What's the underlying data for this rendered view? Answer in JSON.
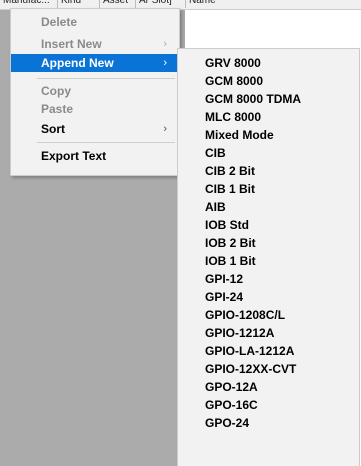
{
  "grid": {
    "columns": [
      "Manufac...",
      "Kind",
      "Asset",
      "Ar Slot]",
      "Name",
      ""
    ]
  },
  "context_menu": {
    "items": [
      {
        "label": "Delete",
        "enabled": false,
        "submenu": false
      },
      {
        "label": "Insert New",
        "enabled": false,
        "submenu": true
      },
      {
        "label": "Append New",
        "enabled": true,
        "submenu": true,
        "highlighted": true
      },
      {
        "label": "Copy",
        "enabled": false,
        "submenu": false
      },
      {
        "label": "Paste",
        "enabled": false,
        "submenu": false
      },
      {
        "label": "Sort",
        "enabled": true,
        "submenu": true
      },
      {
        "label": "Export Text",
        "enabled": true,
        "submenu": false
      }
    ],
    "submenu_arrow": "›"
  },
  "append_new_submenu": {
    "items": [
      "GRV 8000",
      "GCM 8000",
      "GCM 8000 TDMA",
      "MLC 8000",
      "Mixed Mode",
      "CIB",
      "CIB 2 Bit",
      "CIB 1 Bit",
      "AIB",
      "IOB Std",
      "IOB 2 Bit",
      "IOB 1 Bit",
      "GPI-12",
      "GPI-24",
      "GPIO-1208C/L",
      "GPIO-1212A",
      "GPIO-LA-1212A",
      "GPIO-12XX-CVT",
      "GPO-12A",
      "GPO-16C",
      "GPO-24"
    ]
  },
  "colors": {
    "highlight": "#0a74d6",
    "menu_background": "#f2f2f2",
    "disabled_text": "#8a8a8a",
    "app_background": "#ababab"
  }
}
